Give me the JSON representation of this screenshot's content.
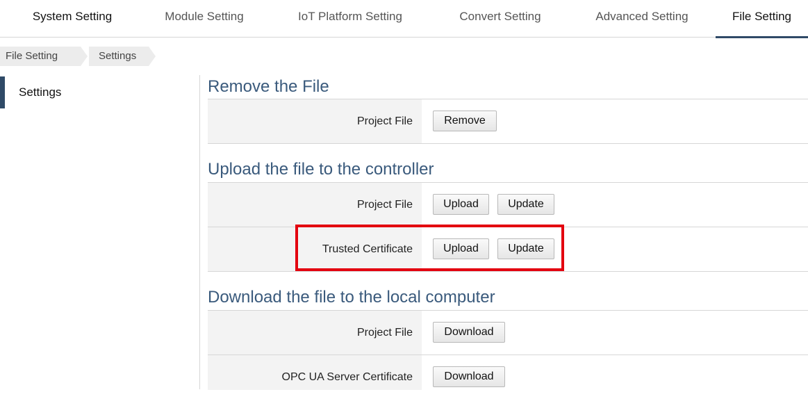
{
  "tabs": [
    {
      "label": "System Setting"
    },
    {
      "label": "Module Setting"
    },
    {
      "label": "IoT Platform Setting"
    },
    {
      "label": "Convert Setting"
    },
    {
      "label": "Advanced Setting"
    },
    {
      "label": "File Setting",
      "active": true
    }
  ],
  "breadcrumb": [
    "File Setting",
    "Settings"
  ],
  "sidebar": {
    "items": [
      {
        "label": "Settings",
        "active": true
      }
    ]
  },
  "sections": [
    {
      "title": "Remove the File",
      "rows": [
        {
          "label": "Project File",
          "buttons": [
            "Remove"
          ]
        }
      ]
    },
    {
      "title": "Upload the file to the controller",
      "rows": [
        {
          "label": "Project File",
          "buttons": [
            "Upload",
            "Update"
          ]
        },
        {
          "label": "Trusted Certificate",
          "buttons": [
            "Upload",
            "Update"
          ]
        }
      ]
    },
    {
      "title": "Download the file to the local computer",
      "rows": [
        {
          "label": "Project File",
          "buttons": [
            "Download"
          ]
        },
        {
          "label": "OPC UA Server Certificate",
          "buttons": [
            "Download"
          ]
        }
      ]
    }
  ],
  "colors": {
    "accent": "#2f4a67",
    "heading": "#3a5a7c",
    "highlight": "#e3000f"
  }
}
